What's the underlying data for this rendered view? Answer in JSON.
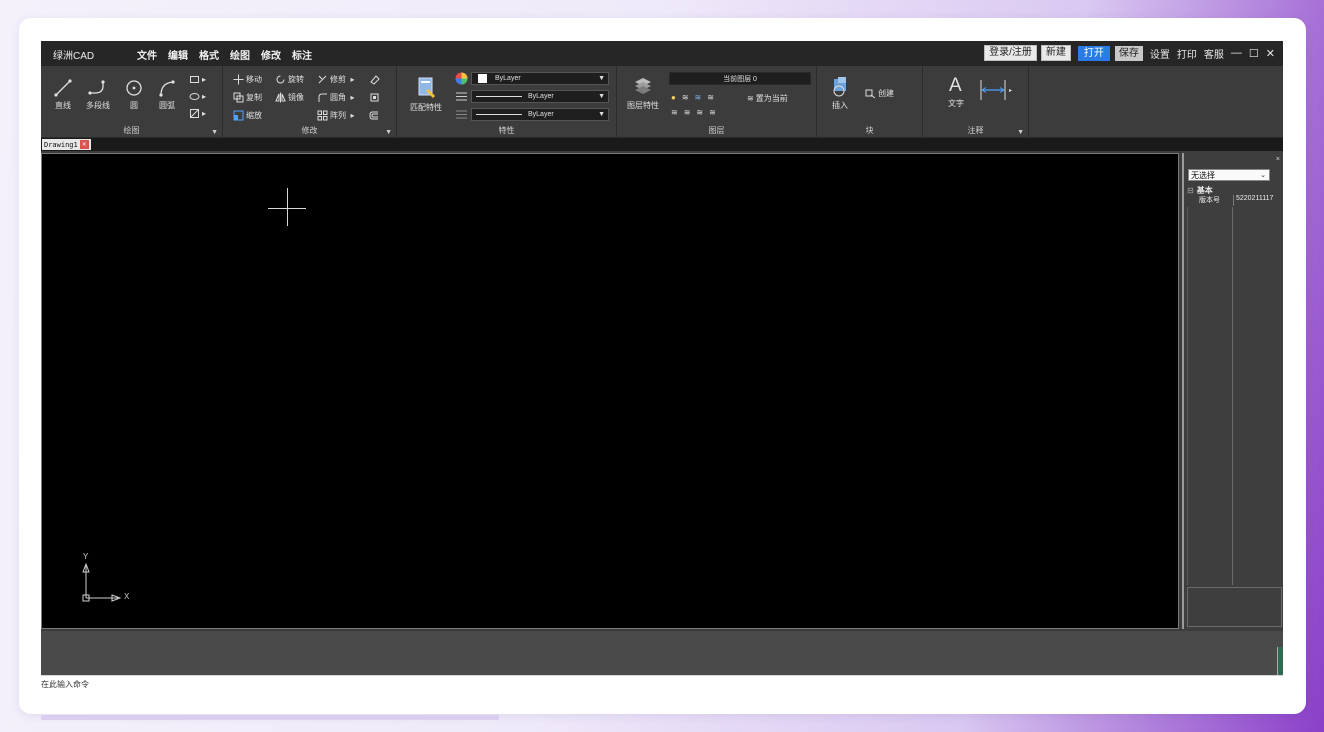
{
  "app": {
    "logo": "绿洲CAD",
    "menus": [
      "文件",
      "编辑",
      "格式",
      "绘图",
      "修改",
      "标注"
    ],
    "right": {
      "login": "登录/注册",
      "new": "新建",
      "open": "打开",
      "save": "保存",
      "settings": "设置",
      "print": "打印",
      "support": "客服"
    },
    "window_controls": [
      "—",
      "☐",
      "✕"
    ]
  },
  "ribbon": {
    "draw": {
      "label": "绘图",
      "tools": [
        "直线",
        "多段线",
        "圆",
        "圆弧"
      ]
    },
    "modify": {
      "label": "修改",
      "items": [
        "移动",
        "旋转",
        "修剪",
        "复制",
        "镜像",
        "圆角",
        "缩放",
        "阵列"
      ]
    },
    "properties": {
      "label": "特性",
      "match": "匹配特性",
      "color": "ByLayer",
      "linetype": "ByLayer",
      "lineweight": "ByLayer"
    },
    "layer": {
      "label": "图层",
      "props": "图层特性",
      "current": "当前图层  0",
      "set_current": "置为当前"
    },
    "block": {
      "label": "块",
      "insert": "插入",
      "create": "创建"
    },
    "annotation": {
      "label": "注释",
      "text": "文字"
    }
  },
  "document": {
    "tab": "Drawing1",
    "tab_close": "✕"
  },
  "canvas": {
    "axis_x": "X",
    "axis_y": "Y"
  },
  "palette": {
    "close": "×",
    "selection": "无选择",
    "group_toggle": "⊟",
    "group": "基本",
    "row_key": "版本号",
    "row_value": "5220211117"
  },
  "command": {
    "prompt": "在此输入命令"
  }
}
